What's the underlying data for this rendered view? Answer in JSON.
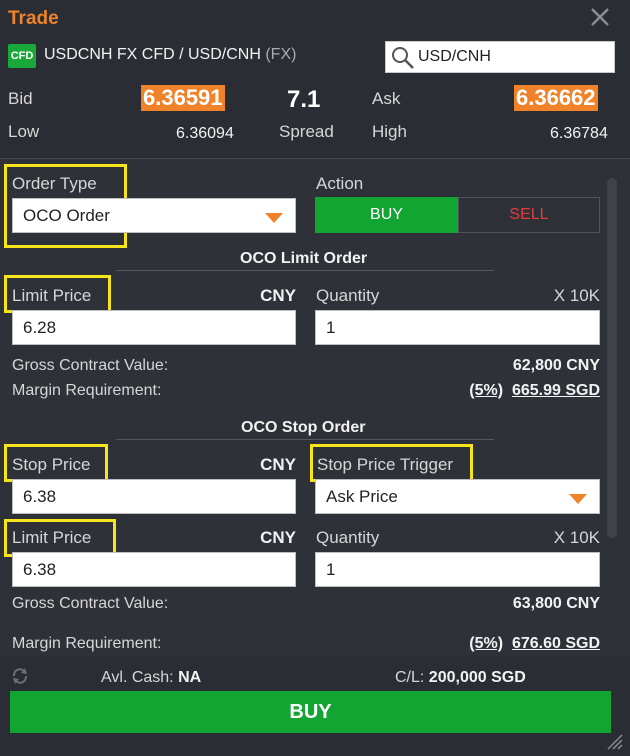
{
  "header": {
    "title": "Trade",
    "cfd_badge": "CFD",
    "instrument": "USDCNH FX CFD / USD/CNH",
    "instrument_type": "(FX)",
    "search_value": "USD/CNH"
  },
  "quote": {
    "bid_label": "Bid",
    "bid": "6.36591",
    "spread_value": "7.1",
    "ask_label": "Ask",
    "ask": "6.36662",
    "low_label": "Low",
    "low": "6.36094",
    "spread_label": "Spread",
    "high_label": "High",
    "high": "6.36784"
  },
  "order": {
    "order_type_label": "Order Type",
    "order_type_value": "OCO Order",
    "action_label": "Action",
    "buy_label": "BUY",
    "sell_label": "SELL"
  },
  "limit_section": {
    "title": "OCO Limit Order",
    "price_label": "Limit Price",
    "currency": "CNY",
    "price_value": "6.28",
    "quantity_label": "Quantity",
    "quantity_unit": "X 10K",
    "quantity_value": "1",
    "gross_label": "Gross Contract Value:",
    "gross_value": "62,800 CNY",
    "margin_label": "Margin Requirement:",
    "margin_pct": "(5%)",
    "margin_value": "665.99 SGD"
  },
  "stop_section": {
    "title": "OCO Stop Order",
    "stop_price_label": "Stop Price",
    "currency": "CNY",
    "stop_price_value": "6.38",
    "trigger_label": "Stop Price Trigger",
    "trigger_value": "Ask Price",
    "limit_price_label": "Limit Price",
    "limit_currency": "CNY",
    "limit_price_value": "6.38",
    "quantity_label": "Quantity",
    "quantity_unit": "X 10K",
    "quantity_value": "1",
    "gross_label": "Gross Contract Value:",
    "gross_value": "63,800 CNY",
    "margin_label": "Margin Requirement:",
    "margin_pct": "(5%)",
    "margin_value": "676.60 SGD"
  },
  "footer": {
    "cash_label": "Avl. Cash:",
    "cash_value": "NA",
    "cl_label": "C/L:",
    "cl_value": "200,000 SGD",
    "buy_button": "BUY"
  },
  "colors": {
    "accent_orange": "#f0832a",
    "buy_green": "#13a532",
    "sell_red": "#e03b3b",
    "highlight_yellow": "#f5e51a",
    "panel_bg": "#2e3238",
    "header_bg": "#2a2d33"
  },
  "icons": {
    "close": "close-icon",
    "search": "search-icon",
    "refresh": "refresh-icon",
    "resize": "resize-grip-icon",
    "dropdown": "chevron-down-icon"
  }
}
